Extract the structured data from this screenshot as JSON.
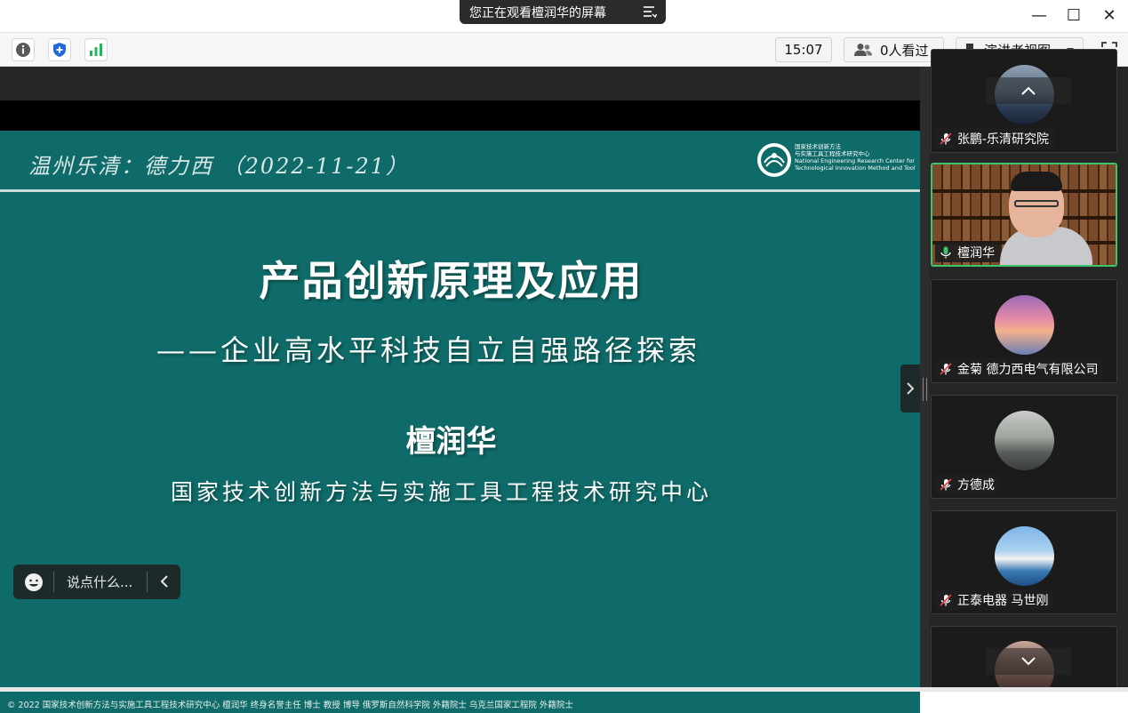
{
  "titlebar": {
    "share_banner": "您正在观看檀润华的屏幕",
    "minimize_glyph": "—",
    "maximize_glyph": "☐",
    "close_glyph": "✕"
  },
  "toolbar": {
    "time": "15:07",
    "viewers": "0人看过",
    "view_mode": "演讲者视图",
    "icons": [
      "info-icon",
      "shield-icon",
      "signal-icon",
      "people-icon",
      "layout-icon",
      "fullscreen-icon"
    ]
  },
  "slide": {
    "header": "温州乐清：德力西   （2022-11-21）",
    "logo_text": "国家技术创新方法\n与实施工具工程技术研究中心\nNational Engineering Research Center for\nTechnological Innovation Method and Tool",
    "title": "产品创新原理及应用",
    "subtitle": "——企业高水平科技自立自强路径探索",
    "presenter": "檀润华",
    "organization": "国家技术创新方法与实施工具工程技术研究中心",
    "footer": "©  2022  国家技术创新方法与实施工具工程技术研究中心  檀润华  终身名誉主任  博士  教授  博导   俄罗斯自然科学院 外籍院士   乌克兰国家工程院 外籍院士"
  },
  "chat": {
    "placeholder": "说点什么..."
  },
  "participants": [
    {
      "name": "张鹏-乐清研究院",
      "mic": "muted"
    },
    {
      "name": "檀润华",
      "mic": "active"
    },
    {
      "name": "金菊 德力西电气有限公司",
      "mic": "muted"
    },
    {
      "name": "方德成",
      "mic": "muted"
    },
    {
      "name": "正泰电器 马世刚",
      "mic": "muted"
    },
    {
      "name": "",
      "mic": "muted"
    }
  ],
  "colors": {
    "slide_bg": "#0f6b69",
    "active_border": "#3ec46d",
    "muted_mic": "#e2434b"
  }
}
